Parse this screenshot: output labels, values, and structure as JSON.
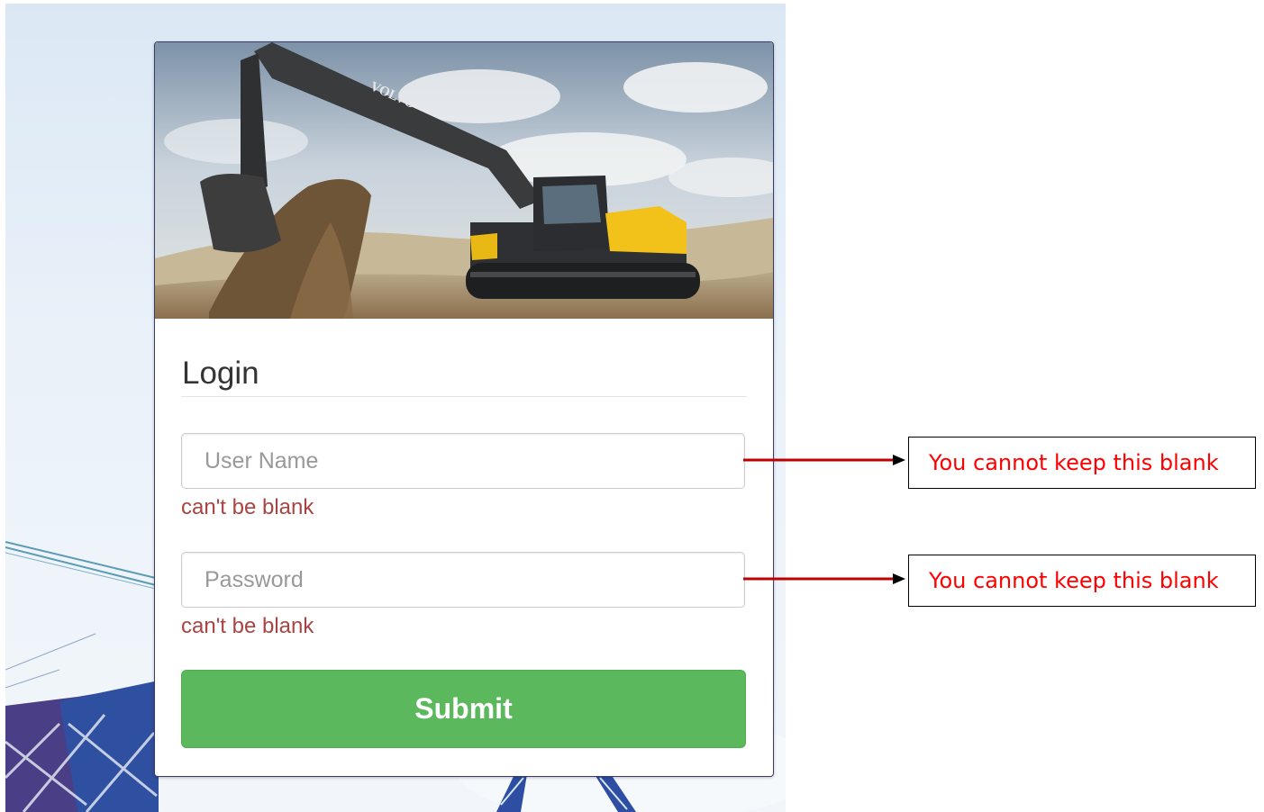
{
  "login": {
    "hero_brand": "VOLVO",
    "title": "Login",
    "username": {
      "placeholder": "User Name",
      "value": "",
      "error": "can't be blank"
    },
    "password": {
      "placeholder": "Password",
      "value": "",
      "error": "can't be blank"
    },
    "submit_label": "Submit"
  },
  "annotations": [
    {
      "text": "You cannot keep this blank",
      "points_to": "username"
    },
    {
      "text": "You cannot keep this blank",
      "points_to": "password"
    }
  ],
  "colors": {
    "submit_bg": "#5cb85c",
    "error_text": "#a94442",
    "callout_text": "#ff0000",
    "arrow": "#c00000"
  }
}
